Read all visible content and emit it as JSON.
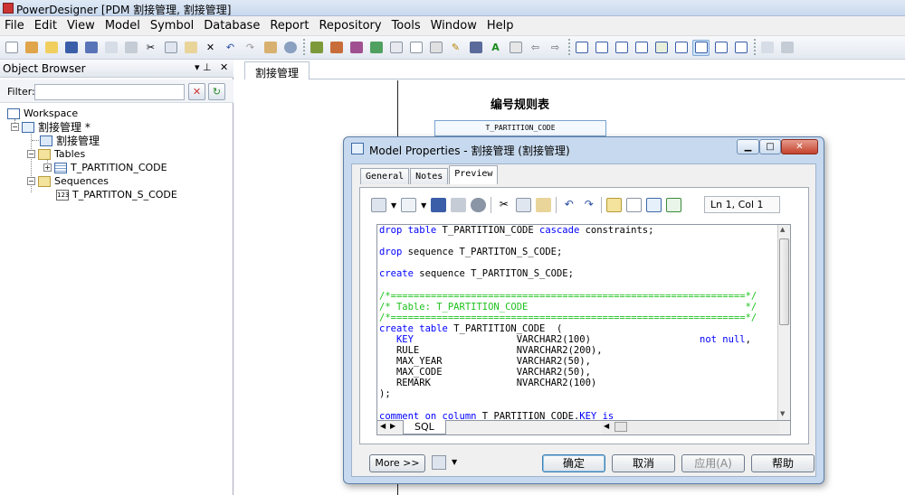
{
  "app": {
    "title": "PowerDesigner [PDM 割接管理, 割接管理]"
  },
  "menu": [
    "File",
    "Edit",
    "View",
    "Model",
    "Symbol",
    "Database",
    "Report",
    "Repository",
    "Tools",
    "Window",
    "Help"
  ],
  "object_browser": {
    "title": "Object Browser",
    "pin": "▾ ⊥",
    "close": "✕",
    "filter_label": "Filter:",
    "filter_value": "",
    "tree": {
      "workspace": "Workspace",
      "model": "割接管理 *",
      "diagram": "割接管理",
      "tables": "Tables",
      "table1": "T_PARTITION_CODE",
      "sequences": "Sequences",
      "seq1": "T_PARTITON_S_CODE",
      "seq_icon": "123"
    }
  },
  "diagram": {
    "tab_label": "割接管理",
    "rule_title": "编号规则表",
    "table_name": "T_PARTITION_CODE"
  },
  "dialog": {
    "title": "Model Properties - 割接管理 (割接管理)",
    "tabs": [
      "General",
      "Notes",
      "Preview"
    ],
    "active_tab": "Preview",
    "ln_col": "Ln 1, Col 1",
    "bottom_tab": "SQL",
    "buttons": {
      "more": "More >>",
      "ok": "确定",
      "cancel": "取消",
      "apply": "应用(A)",
      "help": "帮助"
    },
    "sql_lines": [
      [
        {
          "t": "drop table ",
          "c": "kw"
        },
        {
          "t": "T_PARTITION_CODE ",
          "c": "nm"
        },
        {
          "t": "cascade ",
          "c": "kw"
        },
        {
          "t": "constraints;",
          "c": "nm"
        }
      ],
      [],
      [
        {
          "t": "drop ",
          "c": "kw"
        },
        {
          "t": "sequence T_PARTITON_S_CODE;",
          "c": "nm"
        }
      ],
      [],
      [
        {
          "t": "create ",
          "c": "kw"
        },
        {
          "t": "sequence T_PARTITON_S_CODE;",
          "c": "nm"
        }
      ],
      [],
      [
        {
          "t": "/*==============================================================*/",
          "c": "cmt"
        }
      ],
      [
        {
          "t": "/* Table: T_PARTITION_CODE                                      */",
          "c": "cmt"
        }
      ],
      [
        {
          "t": "/*==============================================================*/",
          "c": "cmt"
        }
      ],
      [
        {
          "t": "create table ",
          "c": "kw"
        },
        {
          "t": "T_PARTITION_CODE  (",
          "c": "nm"
        }
      ],
      [
        {
          "t": "   KEY                  ",
          "c": "kw"
        },
        {
          "t": "VARCHAR2(100)                   ",
          "c": "nm"
        },
        {
          "t": "not null",
          "c": "kw"
        },
        {
          "t": ",",
          "c": "nm"
        }
      ],
      [
        {
          "t": "   RULE                 NVARCHAR2(200),",
          "c": "nm"
        }
      ],
      [
        {
          "t": "   MAX_YEAR             VARCHAR2(50),",
          "c": "nm"
        }
      ],
      [
        {
          "t": "   MAX_CODE             VARCHAR2(50),",
          "c": "nm"
        }
      ],
      [
        {
          "t": "   REMARK               NVARCHAR2(100)",
          "c": "nm"
        }
      ],
      [
        {
          "t": ");",
          "c": "nm"
        }
      ],
      [],
      [
        {
          "t": "comment on column ",
          "c": "kw"
        },
        {
          "t": "T_PARTITION_CODE.",
          "c": "nm"
        },
        {
          "t": "KEY ",
          "c": "kw"
        },
        {
          "t": "is",
          "c": "kw"
        }
      ]
    ]
  }
}
